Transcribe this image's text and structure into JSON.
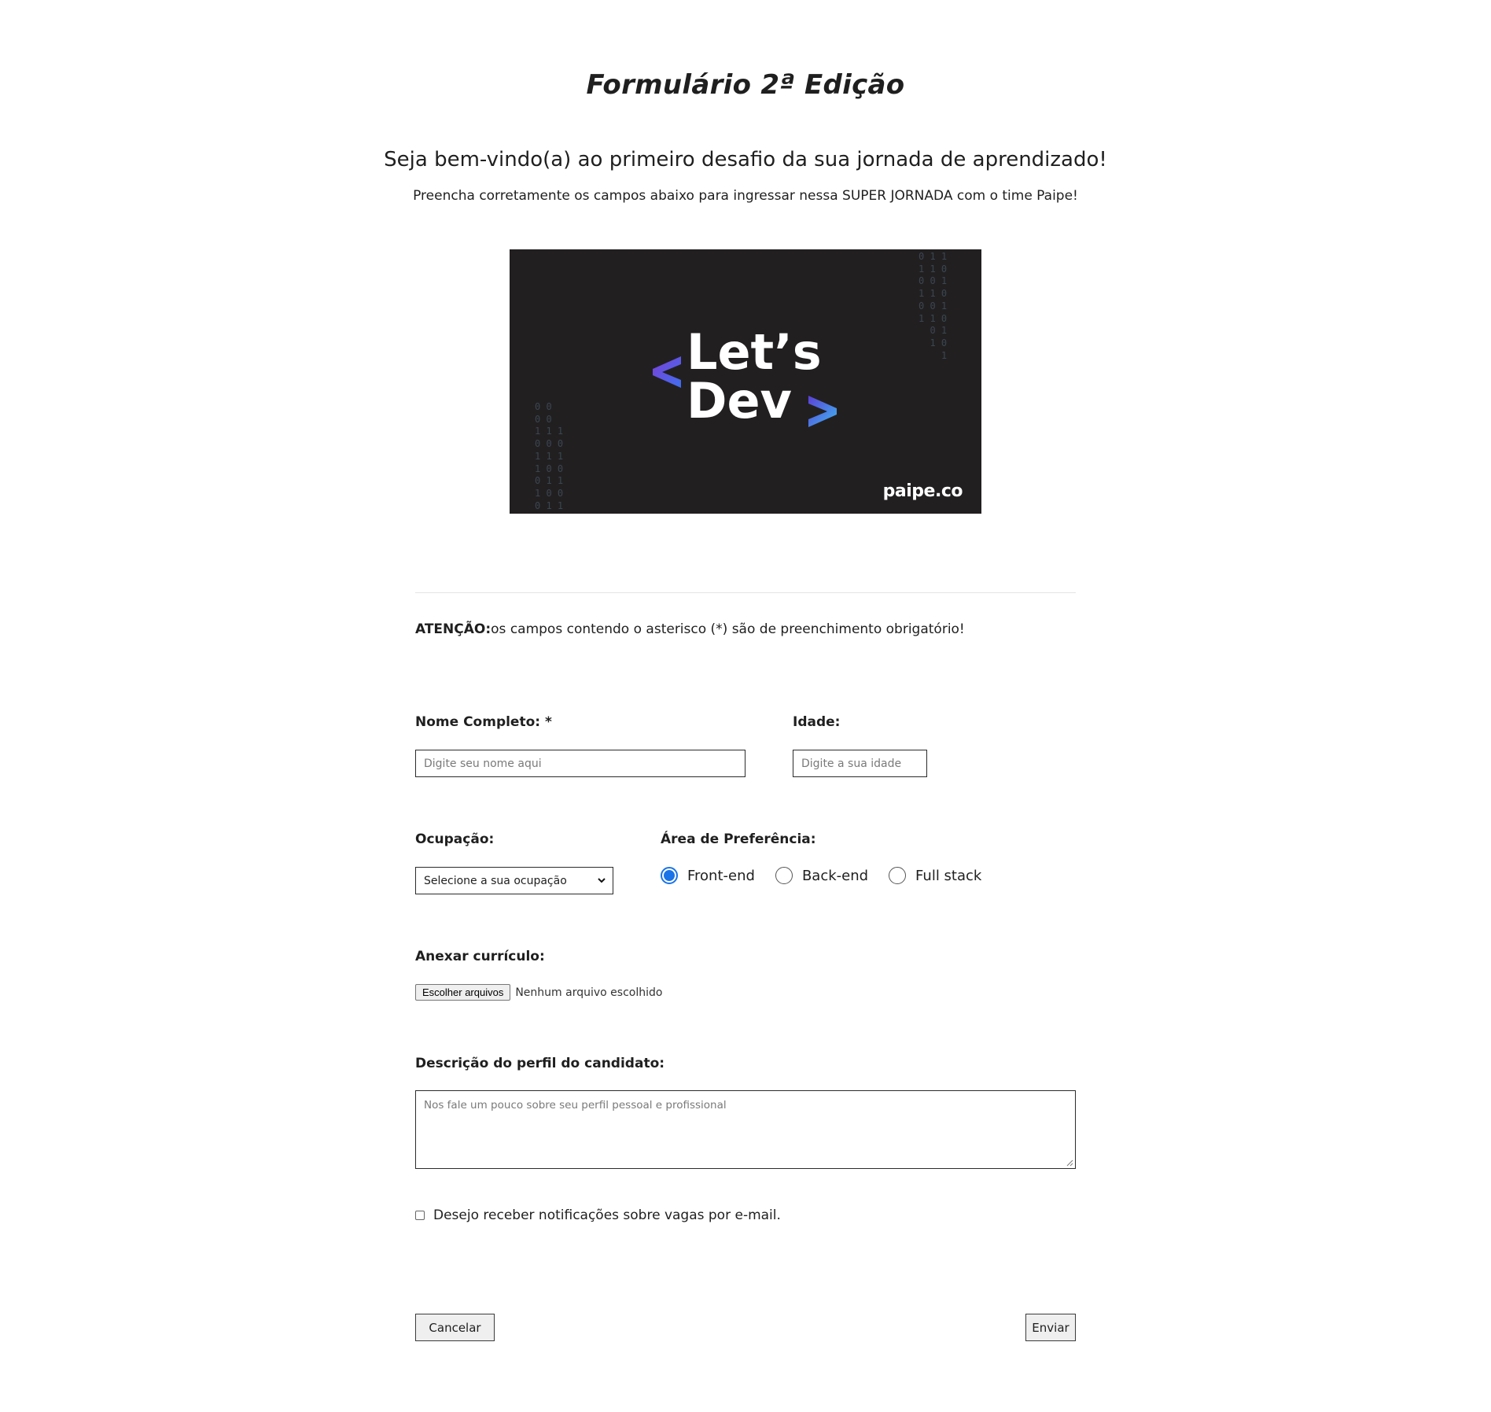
{
  "header": {
    "title": "Formulário 2ª Edição",
    "welcome": "Seja bem-vindo(a) ao primeiro desafio da sua jornada de aprendizado!",
    "subtitle": "Preencha corretamente os campos abaixo para ingressar nessa SUPER JORNADA com o time Paipe!"
  },
  "banner": {
    "line1": "Let’s",
    "line2": "Dev",
    "brand": "paipe.co",
    "background": "#221f20",
    "accent_gradient": [
      "#5a3fd6",
      "#3fb6f0"
    ]
  },
  "attention": {
    "strong": "ATENÇÃO:",
    "text": "os campos contendo o asterisco (*) são de preenchimento obrigatório!"
  },
  "form": {
    "name_label": "Nome Completo: *",
    "name_placeholder": "Digite seu nome aqui",
    "age_label": "Idade:",
    "age_placeholder": "Digite a sua idade",
    "occupation_label": "Ocupação:",
    "occupation_selected": "Selecione a sua ocupação",
    "area_label": "Área de Preferência:",
    "area_options": [
      {
        "label": "Front-end",
        "checked": true
      },
      {
        "label": "Back-end",
        "checked": false
      },
      {
        "label": "Full stack",
        "checked": false
      }
    ],
    "resume_label": "Anexar currículo:",
    "file_button": "Escolher arquivos",
    "file_status": "Nenhum arquivo escolhido",
    "description_label": "Descrição do perfil do candidato:",
    "description_placeholder": "Nos fale um pouco sobre seu perfil pessoal e profissional",
    "notify_label": "Desejo receber notificações sobre vagas por e-mail.",
    "notify_checked": false,
    "cancel_label": "Cancelar",
    "submit_label": "Enviar"
  },
  "colors": {
    "radio_checked": "#1a73e8",
    "text": "#1f1f1f"
  }
}
